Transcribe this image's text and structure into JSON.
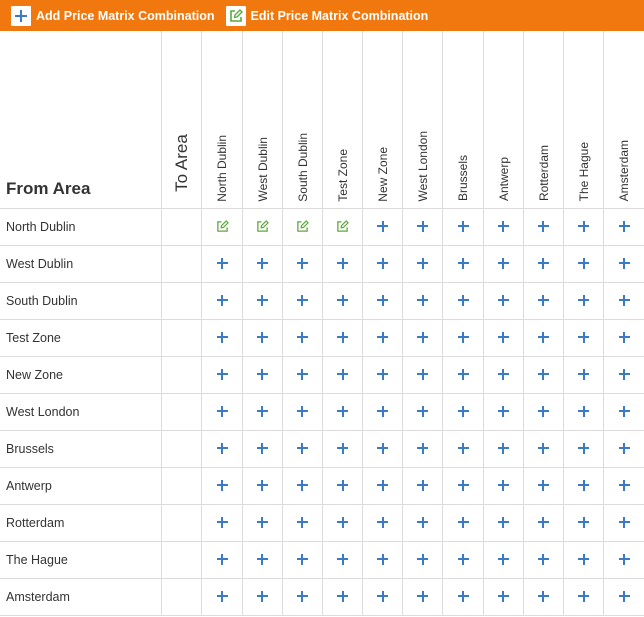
{
  "toolbar": {
    "add_label": "Add Price Matrix Combination",
    "add_icon": "plus-icon",
    "edit_label": "Edit Price Matrix Combination",
    "edit_icon": "edit-icon"
  },
  "matrix": {
    "from_label": "From Area",
    "to_label": "To Area",
    "columns": [
      "North Dublin",
      "West Dublin",
      "South Dublin",
      "Test Zone",
      "New Zone",
      "West London",
      "Brussels",
      "Antwerp",
      "Rotterdam",
      "The Hague",
      "Amsterdam"
    ],
    "rows": [
      {
        "label": "North Dublin",
        "cells": [
          "edit",
          "edit",
          "edit",
          "edit",
          "add",
          "add",
          "add",
          "add",
          "add",
          "add",
          "add"
        ]
      },
      {
        "label": "West Dublin",
        "cells": [
          "add",
          "add",
          "add",
          "add",
          "add",
          "add",
          "add",
          "add",
          "add",
          "add",
          "add"
        ]
      },
      {
        "label": "South Dublin",
        "cells": [
          "add",
          "add",
          "add",
          "add",
          "add",
          "add",
          "add",
          "add",
          "add",
          "add",
          "add"
        ]
      },
      {
        "label": "Test Zone",
        "cells": [
          "add",
          "add",
          "add",
          "add",
          "add",
          "add",
          "add",
          "add",
          "add",
          "add",
          "add"
        ]
      },
      {
        "label": "New Zone",
        "cells": [
          "add",
          "add",
          "add",
          "add",
          "add",
          "add",
          "add",
          "add",
          "add",
          "add",
          "add"
        ]
      },
      {
        "label": "West London",
        "cells": [
          "add",
          "add",
          "add",
          "add",
          "add",
          "add",
          "add",
          "add",
          "add",
          "add",
          "add"
        ]
      },
      {
        "label": "Brussels",
        "cells": [
          "add",
          "add",
          "add",
          "add",
          "add",
          "add",
          "add",
          "add",
          "add",
          "add",
          "add"
        ]
      },
      {
        "label": "Antwerp",
        "cells": [
          "add",
          "add",
          "add",
          "add",
          "add",
          "add",
          "add",
          "add",
          "add",
          "add",
          "add"
        ]
      },
      {
        "label": "Rotterdam",
        "cells": [
          "add",
          "add",
          "add",
          "add",
          "add",
          "add",
          "add",
          "add",
          "add",
          "add",
          "add"
        ]
      },
      {
        "label": "The Hague",
        "cells": [
          "add",
          "add",
          "add",
          "add",
          "add",
          "add",
          "add",
          "add",
          "add",
          "add",
          "add"
        ]
      },
      {
        "label": "Amsterdam",
        "cells": [
          "add",
          "add",
          "add",
          "add",
          "add",
          "add",
          "add",
          "add",
          "add",
          "add",
          "add"
        ]
      }
    ]
  },
  "colors": {
    "toolbar_bg": "#f0780f",
    "add_icon": "#3b7bc4",
    "edit_icon": "#5aab3c",
    "grid_line": "#dcdcdc"
  }
}
